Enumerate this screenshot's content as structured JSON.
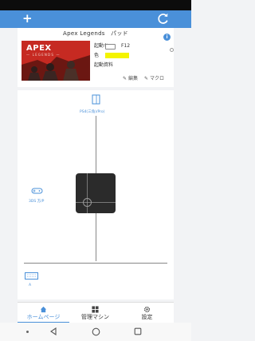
{
  "header": {
    "add_icon": "plus-icon",
    "refresh_icon": "refresh-icon"
  },
  "card": {
    "title": "Apex Legends　パッド",
    "thumbnail": {
      "title": "APEX",
      "subtitle": "— LEGENDS —"
    },
    "fields": [
      {
        "label": "起動キー",
        "value": "F12"
      },
      {
        "label": "色",
        "value": ""
      },
      {
        "label": "起動資料",
        "value": ""
      }
    ],
    "color_swatch": "#f4f400",
    "edit_label": "編集",
    "macro_label": "マクロ"
  },
  "canvas": {
    "top_label": "PS4(三角)/Pro)",
    "left_label": "3DS 方/P",
    "bottom_label": "A"
  },
  "tabs": [
    {
      "label": "ホームページ",
      "icon": "home-icon",
      "active": true
    },
    {
      "label": "管理マシン",
      "icon": "grid-icon",
      "active": false
    },
    {
      "label": "設定",
      "icon": "gear-icon",
      "active": false
    }
  ],
  "colors": {
    "accent": "#4a90d9",
    "brand_red": "#c62a22"
  }
}
